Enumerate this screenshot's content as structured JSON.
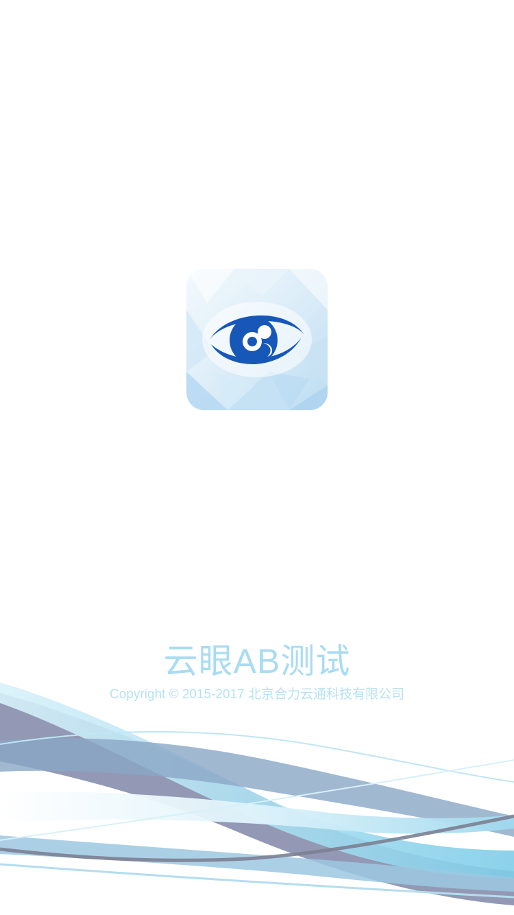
{
  "splash": {
    "logo_icon": "cloud-eye-icon",
    "app_title": "云眼AB测试",
    "copyright": "Copyright © 2015-2017 北京合力云通科技有限公司"
  },
  "colors": {
    "background": "#ffffff",
    "title_text": "#a9dcf2",
    "copyright_text": "#b6e1f4",
    "logo_blue": "#1657b8",
    "wave_gray": "#8d93b0",
    "wave_blue": "#8ccde6"
  }
}
